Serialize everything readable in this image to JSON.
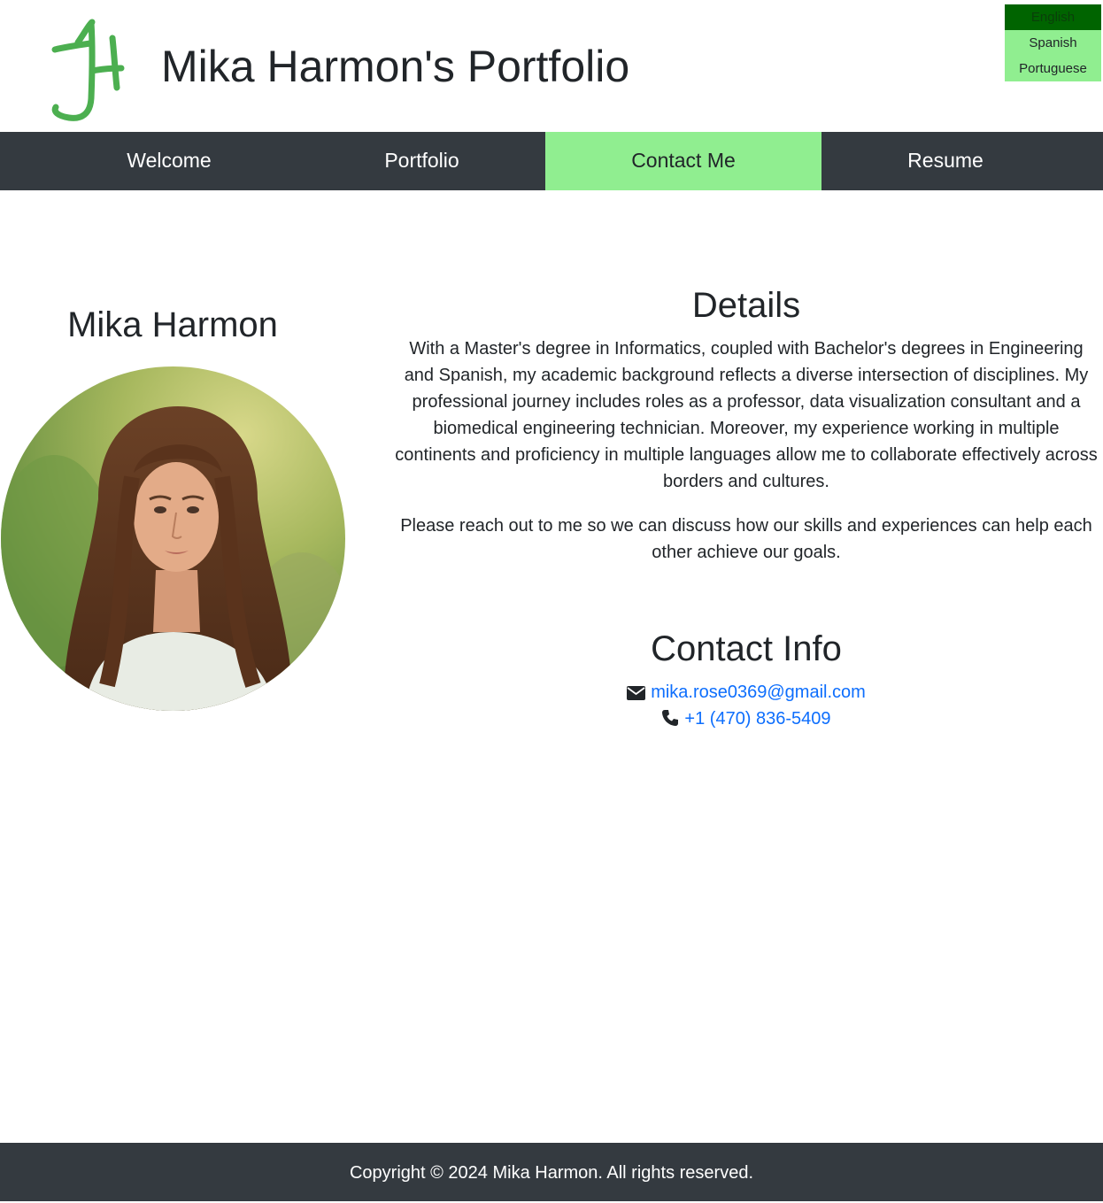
{
  "header": {
    "title": "Mika Harmon's Portfolio",
    "logo_icon": "jh-monogram-logo",
    "logo_color": "#4caf50"
  },
  "language_switcher": {
    "options": [
      "English",
      "Spanish",
      "Portuguese"
    ],
    "selected": "English",
    "selected_color": "#006400",
    "background_color": "#90ee90"
  },
  "nav": {
    "items": [
      {
        "label": "Welcome"
      },
      {
        "label": "Portfolio"
      },
      {
        "label": "Contact Me"
      },
      {
        "label": "Resume"
      }
    ],
    "active": "Contact Me",
    "active_color": "#90ee90",
    "bar_color": "#343a40"
  },
  "profile": {
    "name": "Mika Harmon"
  },
  "details": {
    "heading": "Details",
    "paragraphs": [
      "With a Master's degree in Informatics, coupled with Bachelor's degrees in Engineering and Spanish, my academic background reflects a diverse intersection of disciplines. My professional journey includes roles as a professor, data visualization consultant and a biomedical engineering technician. Moreover, my experience working in multiple continents and proficiency in multiple languages allow me to collaborate effectively across borders and cultures.",
      "Please reach out to me so we can discuss how our skills and experiences can help each other achieve our goals."
    ]
  },
  "contact": {
    "heading": "Contact Info",
    "email": "mika.rose0369@gmail.com",
    "email_icon": "envelope-icon",
    "phone": "+1 (470) 836-5409",
    "phone_icon": "phone-icon",
    "link_color": "#0d6efd"
  },
  "footer": {
    "text": "Copyright © 2024 Mika Harmon. All rights reserved."
  }
}
